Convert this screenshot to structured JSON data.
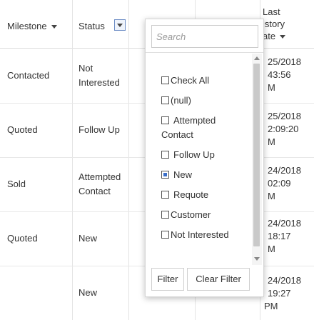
{
  "columns": {
    "milestone": "Milestone",
    "status": "Status",
    "last_history_date": [
      "Last",
      "istory",
      "ate"
    ]
  },
  "rows": [
    {
      "milestone": "Contacted",
      "status": [
        "Not",
        "Interested"
      ],
      "date": [
        "25/2018",
        "43:56",
        "M"
      ]
    },
    {
      "milestone": "Quoted",
      "status": [
        "Follow Up"
      ],
      "date": [
        "25/2018",
        "2:09:20",
        "M"
      ]
    },
    {
      "milestone": "Sold",
      "status": [
        "Attempted",
        "Contact"
      ],
      "date": [
        "24/2018",
        "02:09",
        "M"
      ]
    },
    {
      "milestone": "Quoted",
      "status": [
        "New"
      ],
      "date": [
        "24/2018",
        "18:17",
        "M"
      ]
    },
    {
      "milestone": "",
      "status": [
        "New"
      ],
      "date": [
        "24/2018",
        "19:27",
        "PM"
      ]
    }
  ],
  "filter_popup": {
    "search_placeholder": "Search",
    "options": [
      {
        "label": "Check All",
        "checked": false
      },
      {
        "label": "(null)",
        "checked": false
      },
      {
        "label": "Attempted Contact",
        "checked": false
      },
      {
        "label": "Follow Up",
        "checked": false
      },
      {
        "label": "New",
        "checked": true
      },
      {
        "label": "Requote",
        "checked": false
      },
      {
        "label": "Customer",
        "checked": false
      },
      {
        "label": "Not Interested",
        "checked": false
      }
    ],
    "filter_label": "Filter",
    "clear_filter_label": "Clear Filter"
  },
  "icons": {
    "sort": "sort-down-icon",
    "filter": "filter-dropdown-icon",
    "scroll_up": "scroll-up-icon",
    "scroll_down": "scroll-down-icon"
  },
  "colors": {
    "checked_fill": "#3a6fc9",
    "filter_button_border": "#6a8bc4",
    "grid_line": "#e3e3e3"
  }
}
